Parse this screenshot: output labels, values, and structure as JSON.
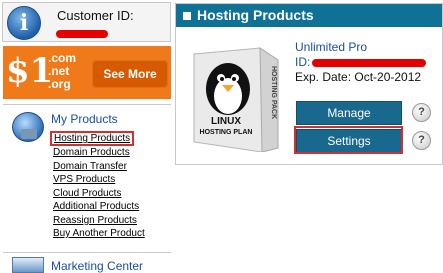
{
  "customer": {
    "label": "Customer ID:",
    "info_icon": "info-icon"
  },
  "promo": {
    "price": "$1",
    "tlds": [
      ".com",
      ".net",
      ".org"
    ],
    "button_label": "See More"
  },
  "sidebar": {
    "title": "My Products",
    "items": [
      {
        "label": "Hosting Products",
        "active": true
      },
      {
        "label": "Domain Products"
      },
      {
        "label": "Domain Transfer"
      },
      {
        "label": "VPS Products"
      },
      {
        "label": "Cloud Products"
      },
      {
        "label": "Additional Products"
      },
      {
        "label": "Reassign Products"
      },
      {
        "label": "Buy Another Product"
      }
    ],
    "next_section": "Marketing Center"
  },
  "panel": {
    "title": "Hosting Products",
    "product_name": "Unlimited Pro",
    "id_label": "ID:",
    "expiration": "Exp. Date: Oct-20-2012",
    "box_art": {
      "side_text": "HOSTING PACK",
      "front_line1": "LINUX",
      "front_line2": "HOSTING PLAN"
    },
    "manage_label": "Manage",
    "settings_label": "Settings",
    "help_glyph": "?"
  },
  "colors": {
    "header": "#0f7195",
    "button": "#19698e",
    "promo": "#f07a1a",
    "highlight": "#d32f2f",
    "redaction": "#e30000"
  }
}
